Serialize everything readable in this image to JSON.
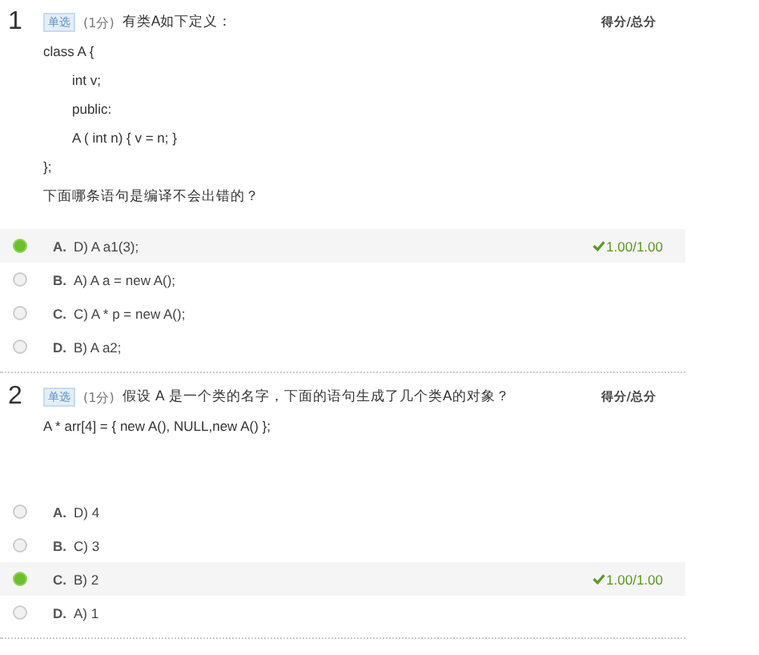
{
  "questions": [
    {
      "number": "1",
      "tag": "单选",
      "points": "(1分)",
      "title": "有类A如下定义：",
      "score_header": "得分/总分",
      "lines": [
        {
          "text": "class A {",
          "indented": false
        },
        {
          "text": "int v;",
          "indented": true
        },
        {
          "text": "public:",
          "indented": true
        },
        {
          "text": "A ( int n) { v = n; }",
          "indented": true
        },
        {
          "text": "};",
          "indented": false
        },
        {
          "text": "下面哪条语句是编译不会出错的？",
          "indented": false
        }
      ],
      "options": [
        {
          "letter": "A.",
          "text": "D)  A a1(3);",
          "selected": true,
          "score": "1.00/1.00"
        },
        {
          "letter": "B.",
          "text": "A)  A a = new A();",
          "selected": false
        },
        {
          "letter": "C.",
          "text": "C)  A * p = new A();",
          "selected": false
        },
        {
          "letter": "D.",
          "text": "B)  A a2;",
          "selected": false
        }
      ]
    },
    {
      "number": "2",
      "tag": "单选",
      "points": "(1分)",
      "title": "假设 A 是一个类的名字，下面的语句生成了几个类A的对象？",
      "score_header": "得分/总分",
      "lines": [
        {
          "text": "A * arr[4] = { new A(), NULL,new A() };",
          "indented": false
        }
      ],
      "options": [
        {
          "letter": "A.",
          "text": "D) 4",
          "selected": false
        },
        {
          "letter": "B.",
          "text": "C) 3",
          "selected": false
        },
        {
          "letter": "C.",
          "text": "B) 2",
          "selected": true,
          "score": "1.00/1.00"
        },
        {
          "letter": "D.",
          "text": "A) 1",
          "selected": false
        }
      ]
    }
  ]
}
